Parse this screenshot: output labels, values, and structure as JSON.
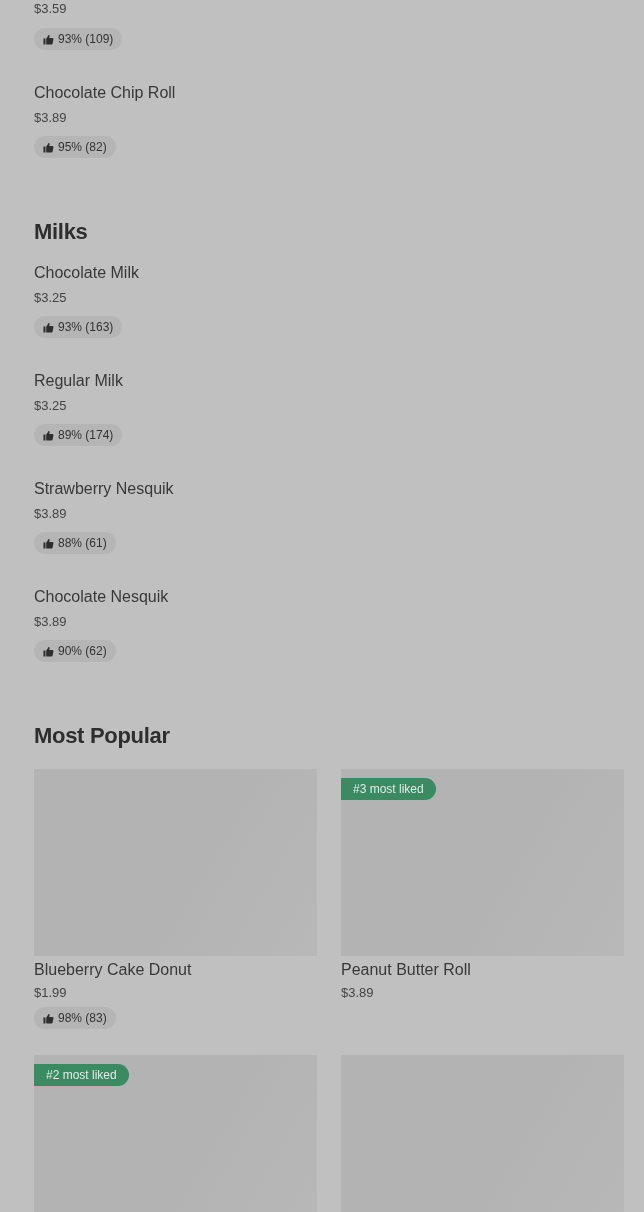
{
  "sections": [
    {
      "items": [
        {
          "price": "$3.59",
          "rating": "93% (109)"
        },
        {
          "name": "Chocolate Chip Roll",
          "price": "$3.89",
          "rating": "95% (82)"
        }
      ]
    },
    {
      "title": "Milks",
      "items": [
        {
          "name": "Chocolate Milk",
          "price": "$3.25",
          "rating": "93% (163)"
        },
        {
          "name": "Regular Milk",
          "price": "$3.25",
          "rating": "89% (174)"
        },
        {
          "name": "Strawberry Nesquik",
          "price": "$3.89",
          "rating": "88% (61)"
        },
        {
          "name": "Chocolate Nesquik",
          "price": "$3.89",
          "rating": "90% (62)"
        }
      ]
    }
  ],
  "most_popular": {
    "title": "Most Popular",
    "cards": [
      {
        "kind": "picture",
        "name": "Blueberry Cake Donut",
        "price": "$1.99",
        "rating": "98% (83)"
      },
      {
        "kind": "picture",
        "badge": "#3 most liked",
        "name": "Peanut Butter Roll",
        "price": "$3.89"
      },
      {
        "kind": "picture",
        "badge": "#2 most liked"
      },
      {
        "kind": "picture"
      }
    ]
  }
}
